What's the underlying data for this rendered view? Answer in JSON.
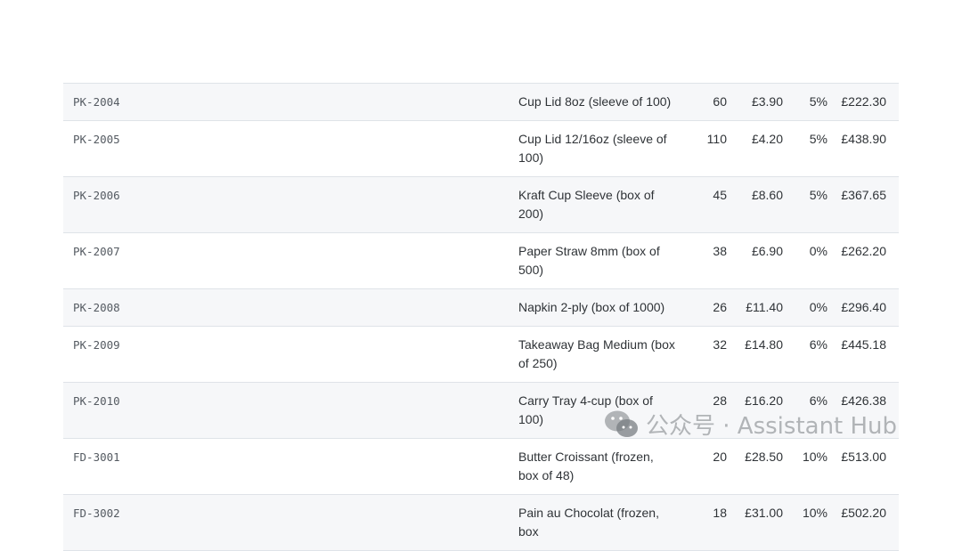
{
  "rows": [
    {
      "sku": "PK-2004",
      "description": "Cup Lid 8oz (sleeve of 100)",
      "qty": "60",
      "unit_price": "£3.90",
      "discount": "5%",
      "total": "£222.30"
    },
    {
      "sku": "PK-2005",
      "description": "Cup Lid 12/16oz (sleeve of 100)",
      "qty": "110",
      "unit_price": "£4.20",
      "discount": "5%",
      "total": "£438.90"
    },
    {
      "sku": "PK-2006",
      "description": "Kraft Cup Sleeve (box of 200)",
      "qty": "45",
      "unit_price": "£8.60",
      "discount": "5%",
      "total": "£367.65"
    },
    {
      "sku": "PK-2007",
      "description": "Paper Straw 8mm (box of 500)",
      "qty": "38",
      "unit_price": "£6.90",
      "discount": "0%",
      "total": "£262.20"
    },
    {
      "sku": "PK-2008",
      "description": "Napkin 2-ply (box of 1000)",
      "qty": "26",
      "unit_price": "£11.40",
      "discount": "0%",
      "total": "£296.40"
    },
    {
      "sku": "PK-2009",
      "description": "Takeaway Bag Medium (box of 250)",
      "qty": "32",
      "unit_price": "£14.80",
      "discount": "6%",
      "total": "£445.18"
    },
    {
      "sku": "PK-2010",
      "description": "Carry Tray 4-cup (box of 100)",
      "qty": "28",
      "unit_price": "£16.20",
      "discount": "6%",
      "total": "£426.38"
    },
    {
      "sku": "FD-3001",
      "description": "Butter Croissant (frozen, box of 48)",
      "qty": "20",
      "unit_price": "£28.50",
      "discount": "10%",
      "total": "£513.00"
    },
    {
      "sku": "FD-3002",
      "description": "Pain au Chocolat (frozen, box",
      "qty": "18",
      "unit_price": "£31.00",
      "discount": "10%",
      "total": "£502.20"
    }
  ],
  "watermark": {
    "text": "公众号 · Assistant Hub",
    "icon": "wechat-icon"
  }
}
